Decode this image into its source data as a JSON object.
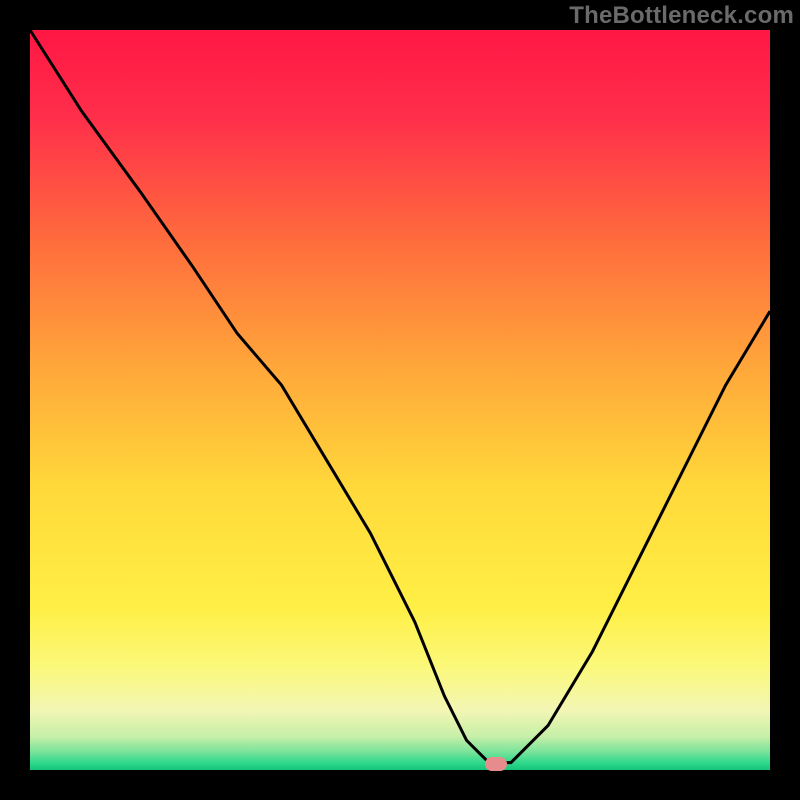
{
  "watermark": {
    "text": "TheBottleneck.com"
  },
  "chart_data": {
    "type": "line",
    "title": "",
    "xlabel": "",
    "ylabel": "",
    "xlim": [
      0,
      100
    ],
    "ylim": [
      0,
      100
    ],
    "grid": false,
    "legend": false,
    "background_gradient": {
      "stops": [
        {
          "pos": 0.0,
          "color": "#ff1744"
        },
        {
          "pos": 0.12,
          "color": "#ff2f4a"
        },
        {
          "pos": 0.28,
          "color": "#ff6a3d"
        },
        {
          "pos": 0.45,
          "color": "#ffa53a"
        },
        {
          "pos": 0.62,
          "color": "#ffd93a"
        },
        {
          "pos": 0.78,
          "color": "#ffef45"
        },
        {
          "pos": 0.86,
          "color": "#fbf87a"
        },
        {
          "pos": 0.92,
          "color": "#f2f6b4"
        },
        {
          "pos": 0.955,
          "color": "#c6efa8"
        },
        {
          "pos": 0.975,
          "color": "#7be39a"
        },
        {
          "pos": 0.99,
          "color": "#2fd98c"
        },
        {
          "pos": 1.0,
          "color": "#14c47a"
        }
      ]
    },
    "series": [
      {
        "name": "bottleneck-curve",
        "x": [
          0,
          7,
          15,
          22,
          28,
          34,
          40,
          46,
          52,
          56,
          59,
          62,
          65,
          70,
          76,
          82,
          88,
          94,
          100
        ],
        "y": [
          100,
          89,
          78,
          68,
          59,
          52,
          42,
          32,
          20,
          10,
          4,
          1,
          1,
          6,
          16,
          28,
          40,
          52,
          62
        ]
      }
    ],
    "annotations": [
      {
        "name": "optimal-marker",
        "x": 63,
        "y": 0.8,
        "color": "#e78c8c"
      }
    ]
  }
}
